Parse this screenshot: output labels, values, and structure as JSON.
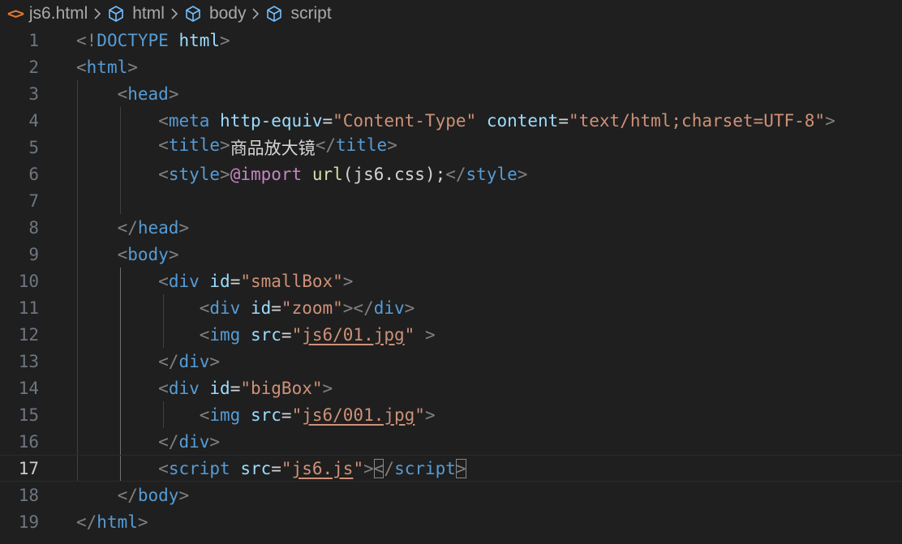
{
  "breadcrumb": {
    "file": "js6.html",
    "items": [
      "html",
      "body",
      "script"
    ]
  },
  "editor": {
    "line_numbers": [
      "1",
      "2",
      "3",
      "4",
      "5",
      "6",
      "7",
      "8",
      "9",
      "10",
      "11",
      "12",
      "13",
      "14",
      "15",
      "16",
      "17",
      "18",
      "19"
    ],
    "current_line": 17,
    "lines": [
      [
        [
          "p",
          "<!"
        ],
        [
          "t",
          "DOCTYPE"
        ],
        [
          "x",
          " "
        ],
        [
          "a",
          "html"
        ],
        [
          "p",
          ">"
        ]
      ],
      [
        [
          "p",
          "<"
        ],
        [
          "t",
          "html"
        ],
        [
          "p",
          ">"
        ]
      ],
      [
        [
          "x",
          "    "
        ],
        [
          "p",
          "<"
        ],
        [
          "t",
          "head"
        ],
        [
          "p",
          ">"
        ]
      ],
      [
        [
          "x",
          "        "
        ],
        [
          "p",
          "<"
        ],
        [
          "t",
          "meta"
        ],
        [
          "x",
          " "
        ],
        [
          "a",
          "http-equiv"
        ],
        [
          "x",
          "="
        ],
        [
          "s",
          "\"Content-Type\""
        ],
        [
          "x",
          " "
        ],
        [
          "a",
          "content"
        ],
        [
          "x",
          "="
        ],
        [
          "s",
          "\"text/html;charset=UTF-8\""
        ],
        [
          "p",
          ">"
        ]
      ],
      [
        [
          "x",
          "        "
        ],
        [
          "p",
          "<"
        ],
        [
          "t",
          "title"
        ],
        [
          "p",
          ">"
        ],
        [
          "x",
          "商品放大镜"
        ],
        [
          "p",
          "</"
        ],
        [
          "t",
          "title"
        ],
        [
          "p",
          ">"
        ]
      ],
      [
        [
          "x",
          "        "
        ],
        [
          "p",
          "<"
        ],
        [
          "t",
          "style"
        ],
        [
          "p",
          ">"
        ],
        [
          "k",
          "@import"
        ],
        [
          "x",
          " "
        ],
        [
          "f",
          "url"
        ],
        [
          "x",
          "(js6.css);"
        ],
        [
          "p",
          "</"
        ],
        [
          "t",
          "style"
        ],
        [
          "p",
          ">"
        ]
      ],
      [],
      [
        [
          "x",
          "    "
        ],
        [
          "p",
          "</"
        ],
        [
          "t",
          "head"
        ],
        [
          "p",
          ">"
        ]
      ],
      [
        [
          "x",
          "    "
        ],
        [
          "p",
          "<"
        ],
        [
          "t",
          "body"
        ],
        [
          "p",
          ">"
        ]
      ],
      [
        [
          "x",
          "        "
        ],
        [
          "p",
          "<"
        ],
        [
          "t",
          "div"
        ],
        [
          "x",
          " "
        ],
        [
          "a",
          "id"
        ],
        [
          "x",
          "="
        ],
        [
          "s",
          "\"smallBox\""
        ],
        [
          "p",
          ">"
        ]
      ],
      [
        [
          "x",
          "            "
        ],
        [
          "p",
          "<"
        ],
        [
          "t",
          "div"
        ],
        [
          "x",
          " "
        ],
        [
          "a",
          "id"
        ],
        [
          "x",
          "="
        ],
        [
          "s",
          "\"zoom\""
        ],
        [
          "p",
          "></"
        ],
        [
          "t",
          "div"
        ],
        [
          "p",
          ">"
        ]
      ],
      [
        [
          "x",
          "            "
        ],
        [
          "p",
          "<"
        ],
        [
          "t",
          "img"
        ],
        [
          "x",
          " "
        ],
        [
          "a",
          "src"
        ],
        [
          "x",
          "="
        ],
        [
          "s",
          "\""
        ],
        [
          "u",
          "js6/01.jpg"
        ],
        [
          "s",
          "\""
        ],
        [
          "x",
          " "
        ],
        [
          "p",
          ">"
        ]
      ],
      [
        [
          "x",
          "        "
        ],
        [
          "p",
          "</"
        ],
        [
          "t",
          "div"
        ],
        [
          "p",
          ">"
        ]
      ],
      [
        [
          "x",
          "        "
        ],
        [
          "p",
          "<"
        ],
        [
          "t",
          "div"
        ],
        [
          "x",
          " "
        ],
        [
          "a",
          "id"
        ],
        [
          "x",
          "="
        ],
        [
          "s",
          "\"bigBox\""
        ],
        [
          "p",
          ">"
        ]
      ],
      [
        [
          "x",
          "            "
        ],
        [
          "p",
          "<"
        ],
        [
          "t",
          "img"
        ],
        [
          "x",
          " "
        ],
        [
          "a",
          "src"
        ],
        [
          "x",
          "="
        ],
        [
          "s",
          "\""
        ],
        [
          "u",
          "js6/001.jpg"
        ],
        [
          "s",
          "\""
        ],
        [
          "p",
          ">"
        ]
      ],
      [
        [
          "x",
          "        "
        ],
        [
          "p",
          "</"
        ],
        [
          "t",
          "div"
        ],
        [
          "p",
          ">"
        ]
      ],
      [
        [
          "x",
          "        "
        ],
        [
          "p",
          "<"
        ],
        [
          "t",
          "script"
        ],
        [
          "x",
          " "
        ],
        [
          "a",
          "src"
        ],
        [
          "x",
          "="
        ],
        [
          "s",
          "\""
        ],
        [
          "u",
          "js6.js"
        ],
        [
          "s",
          "\""
        ],
        [
          "p",
          ">"
        ],
        [
          "bh",
          "<"
        ],
        [
          "p",
          "/"
        ],
        [
          "t",
          "script"
        ],
        [
          "bh",
          ">"
        ]
      ],
      [
        [
          "x",
          "    "
        ],
        [
          "p",
          "</"
        ],
        [
          "t",
          "body"
        ],
        [
          "p",
          ">"
        ]
      ],
      [
        [
          "p",
          "</"
        ],
        [
          "t",
          "html"
        ],
        [
          "p",
          ">"
        ]
      ]
    ]
  },
  "colors": {
    "background": "#1f1f1f",
    "tag": "#569cd6",
    "attribute": "#9cdcfe",
    "string": "#ce9178",
    "punctuation": "#808080",
    "at_rule": "#c586c0",
    "function": "#dcdcaa",
    "text": "#d4d4d4",
    "file_icon": "#e37933",
    "cube_icon": "#75beff"
  }
}
